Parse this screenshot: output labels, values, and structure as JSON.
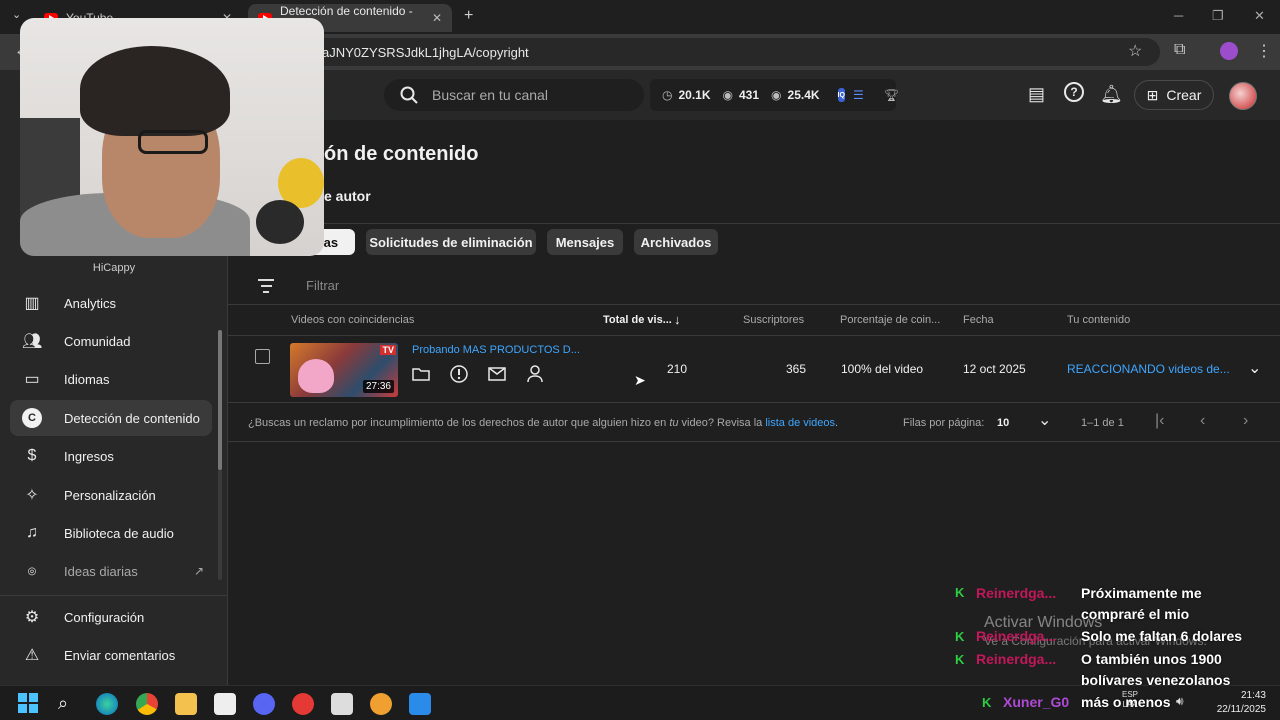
{
  "browser": {
    "tabs": [
      {
        "title": "YouTube"
      },
      {
        "title": "Detección de contenido - YouTu"
      }
    ],
    "new_tab": "+",
    "url": "aJNY0ZYSRSJdkL1jhgLA/copyright"
  },
  "header": {
    "search_placeholder": "Buscar en tu canal",
    "stats": [
      {
        "icon": "clock-icon",
        "value": "20.1K"
      },
      {
        "icon": "eye-icon",
        "value": "431"
      },
      {
        "icon": "eye-icon",
        "value": "25.4K"
      }
    ],
    "create_label": "Crear"
  },
  "sidebar": {
    "channel_name": "HiCappy",
    "items": [
      {
        "label": "Analytics",
        "icon": "analytics-icon"
      },
      {
        "label": "Comunidad",
        "icon": "community-icon"
      },
      {
        "label": "Idiomas",
        "icon": "subtitles-icon"
      },
      {
        "label": "Detección de contenido",
        "icon": "copyright-icon",
        "active": true
      },
      {
        "label": "Ingresos",
        "icon": "dollar-icon"
      },
      {
        "label": "Personalización",
        "icon": "magic-wand-icon"
      },
      {
        "label": "Biblioteca de audio",
        "icon": "audio-library-icon"
      },
      {
        "label": "Ideas diarias",
        "icon": "ideas-icon"
      }
    ],
    "bottom_items": [
      {
        "label": "Configuración",
        "icon": "gear-icon"
      },
      {
        "label": "Enviar comentarios",
        "icon": "feedback-icon"
      }
    ]
  },
  "main": {
    "title": "ón de contenido",
    "subtab": "e autor",
    "chips": [
      {
        "label": "ncias",
        "selected": true
      },
      {
        "label": "Solicitudes de eliminación"
      },
      {
        "label": "Mensajes"
      },
      {
        "label": "Archivados"
      }
    ],
    "filter_placeholder": "Filtrar",
    "columns": [
      "Videos con coincidencias",
      "Total de vis...",
      "Suscriptores",
      "Porcentaje de coin...",
      "Fecha",
      "Tu contenido"
    ],
    "rows": [
      {
        "title": "Probando MAS PRODUCTOS D...",
        "duration": "27:36",
        "views": "210",
        "subscribers": "365",
        "percentage": "100% del video",
        "date": "12 oct 2025",
        "your_content": "REACCIONANDO videos de..."
      }
    ],
    "footer_note_prefix": "¿Buscas un reclamo por incumplimiento de los derechos de autor que alguien hizo en ",
    "footer_note_em": "tu",
    "footer_note_mid": " video? Revisa la ",
    "footer_note_link": "lista de videos",
    "footer_note_end": ".",
    "rows_per_page_label": "Filas por página:",
    "rows_per_page_value": "10",
    "range": "1–1 de 1"
  },
  "chat": [
    {
      "user": "Reinerdga...",
      "message": "Próximamente me"
    },
    {
      "user": "",
      "message": "compraré el mio"
    },
    {
      "user": "Reinerdga...",
      "message": "Solo me faltan 6 dolares"
    },
    {
      "user": "Reinerdga...",
      "message": "O también unos 1900"
    },
    {
      "user": "",
      "message": "bolívares venezolanos"
    },
    {
      "user": "Xuner_G0",
      "message": "más o menos"
    }
  ],
  "watermark": {
    "line1": "Activar Windows",
    "line2": "Ve a Configuración para activar Windows."
  },
  "taskbar": {
    "lang": "ESP",
    "lang2": "LAA",
    "time": "21:43",
    "date": "22/11/2025"
  }
}
